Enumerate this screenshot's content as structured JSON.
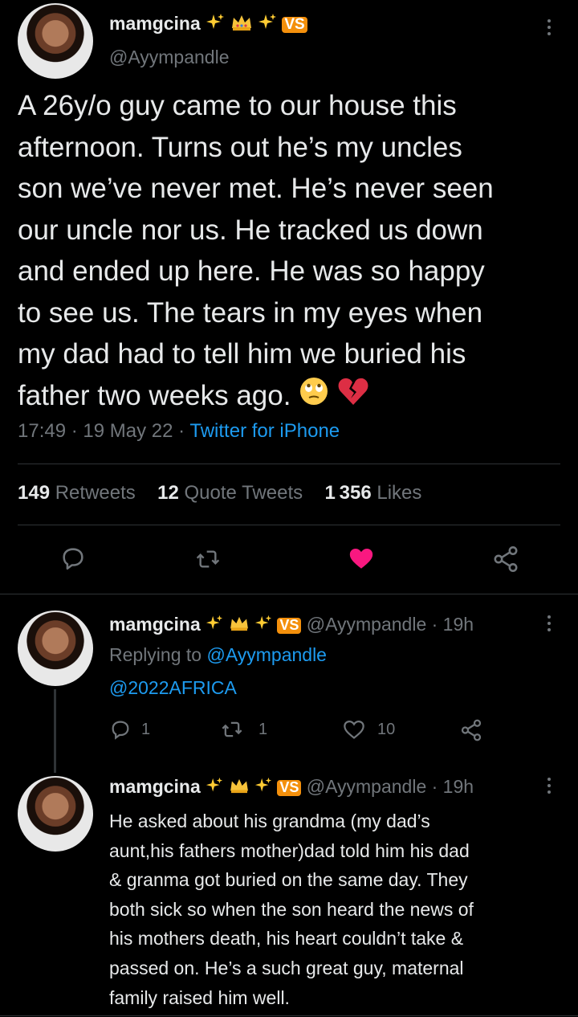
{
  "main_tweet": {
    "display_name": "mamgcina",
    "badge_text": "VS",
    "handle": "@Ayympandle",
    "lines": [
      "A 26y/o guy came to our house this",
      "afternoon. Turns out he’s my uncles",
      "son we’ve never met. He’s never seen",
      "our uncle nor us. He tracked us down",
      "and ended up here. He was so happy",
      "to see us. The tears in my eyes when",
      "my dad had to tell him we buried his",
      "father two weeks ago."
    ],
    "time": "17:49",
    "sep": "·",
    "date": "19 May 22",
    "source": "Twitter for iPhone",
    "retweets_count": "149",
    "retweets_label": "Retweets",
    "quotes_count": "12",
    "quotes_label": "Quote Tweets",
    "likes_count": "1 356",
    "likes_label": "Likes"
  },
  "reply1": {
    "display_name": "mamgcina",
    "badge_text": "VS",
    "handle_time": "@Ayympandle · 19h",
    "replying_prefix": "Replying to",
    "replying_handle": "@Ayympandle",
    "body": "@2022AFRICA",
    "reply_count": "1",
    "retweet_count": "1",
    "like_count": "10"
  },
  "reply2": {
    "display_name": "mamgcina",
    "badge_text": "VS",
    "handle_time": "@Ayympandle · 19h",
    "lines": [
      "He asked about his grandma (my dad’s",
      "aunt,his fathers mother)dad told him his dad",
      "& granma got buried on the same day. They",
      "both sick so when the son heard the news of",
      "his mothers death, his heart couldn’t take &",
      "passed on. He’s a such great guy, maternal",
      "family raised him well."
    ]
  },
  "colors": {
    "background": "#000000",
    "text": "#e7e9ea",
    "muted": "#71767b",
    "link": "#1d9bf0",
    "like": "#f91880",
    "divider": "#2f3336"
  },
  "icons": [
    "sparkles-icon",
    "crown-icon",
    "more-icon",
    "rolling-eyes-emoji",
    "broken-heart-emoji",
    "reply-icon",
    "retweet-icon",
    "like-icon",
    "share-icon"
  ]
}
